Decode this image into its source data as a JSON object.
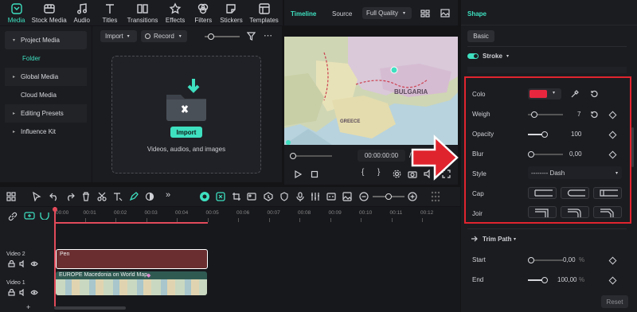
{
  "toolbar": {
    "items": [
      {
        "label": "Media",
        "icon": "media-icon",
        "active": true
      },
      {
        "label": "Stock Media",
        "icon": "stock-media-icon"
      },
      {
        "label": "Audio",
        "icon": "audio-icon"
      },
      {
        "label": "Titles",
        "icon": "titles-icon"
      },
      {
        "label": "Transitions",
        "icon": "transitions-icon"
      },
      {
        "label": "Effects",
        "icon": "effects-icon"
      },
      {
        "label": "Filters",
        "icon": "filters-icon"
      },
      {
        "label": "Stickers",
        "icon": "stickers-icon"
      },
      {
        "label": "Templates",
        "icon": "templates-icon"
      }
    ]
  },
  "media_sidebar": {
    "items": [
      {
        "label": "Project Media",
        "arrow": "▾"
      },
      {
        "label": "Folder",
        "arrow": ""
      },
      {
        "label": "Global Media",
        "arrow": "▸"
      },
      {
        "label": "Cloud Media",
        "arrow": ""
      },
      {
        "label": "Editing Presets",
        "arrow": "▸"
      },
      {
        "label": "Influence Kit",
        "arrow": "▸"
      }
    ]
  },
  "media_main": {
    "import_label": "Import",
    "record_label": "Record",
    "import_button": "Import",
    "drop_hint": "Videos, audios, and images"
  },
  "preview": {
    "tab_timeline": "Timeline",
    "tab_source": "Source",
    "quality": "Full Quality",
    "timecode": "00:00:00:00",
    "map_labels": [
      "BULGARIA",
      "GREECE"
    ]
  },
  "right_panel": {
    "tab_shape": "Shape",
    "tab_basic": "Basic",
    "stroke_label": "Stroke",
    "color_label": "Colo",
    "color_value": "#e8273f",
    "weight_label": "Weigh",
    "weight_value": "7",
    "opacity_label": "Opacity",
    "opacity_value": "100",
    "blur_label": "Blur",
    "blur_value": "0,00",
    "style_label": "Style",
    "style_value": "-------- Dash",
    "cap_label": "Cap",
    "join_label": "Joir",
    "trim_label": "Trim Path",
    "start_label": "Start",
    "start_value": "0,00",
    "start_unit": "%",
    "end_label": "End",
    "end_value": "100,00",
    "end_unit": "%",
    "reset_label": "Reset"
  },
  "timeline": {
    "ticks": [
      "00:00",
      "00:01",
      "00:02",
      "00:03",
      "00:04",
      "00:05",
      "00:06",
      "00:07",
      "00:08",
      "00:09",
      "00:10",
      "00:11",
      "00:12"
    ],
    "track2_label": "Video 2",
    "track1_label": "Video 1",
    "clip_shape": "Pen",
    "clip_video": "EUROPE Macedonia on World Map"
  },
  "colors": {
    "accent": "#3ee0c0",
    "highlight": "#e0242e",
    "clip_shape": "#6a2e30"
  }
}
